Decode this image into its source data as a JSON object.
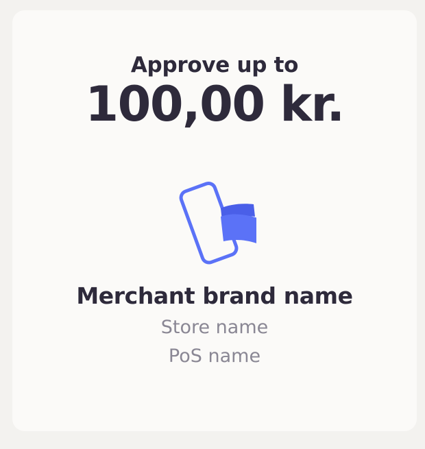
{
  "approval": {
    "label": "Approve up to",
    "amount": "100,00 kr."
  },
  "merchant": {
    "brand_name": "Merchant brand name",
    "store_name": "Store name",
    "pos_name": "PoS name"
  },
  "icons": {
    "illustration": "phone-with-cards-icon"
  },
  "colors": {
    "accent": "#5b72f7",
    "text_primary": "#2e2a3b",
    "text_secondary": "#8a8794",
    "card_background": "#fbfaf8",
    "page_background": "#f3f2ef"
  }
}
